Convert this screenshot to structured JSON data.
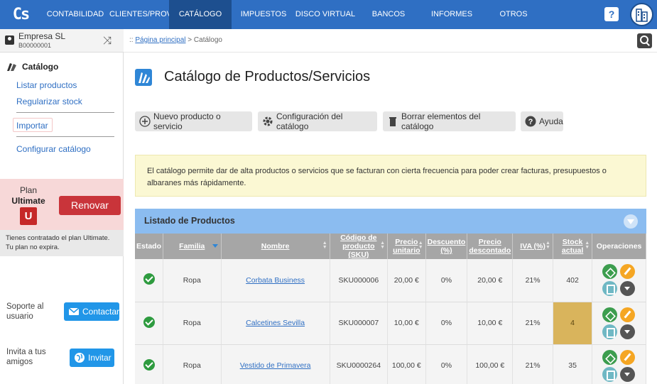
{
  "app": {
    "logo": "Cs"
  },
  "nav": {
    "items": [
      "CONTABILIDAD",
      "CLIENTES/PROV.",
      "CATÁLOGO",
      "IMPUESTOS",
      "DISCO VIRTUAL",
      "BANCOS",
      "INFORMES",
      "OTROS"
    ],
    "active": "CATÁLOGO",
    "help": "?"
  },
  "company": {
    "name": "Empresa SL",
    "id": "B00000001"
  },
  "sidebar": {
    "section": "Catálogo",
    "links": [
      "Listar productos",
      "Regularizar stock",
      "Importar",
      "Configurar catálogo"
    ]
  },
  "plan": {
    "label": "Plan",
    "name": "Ultimate",
    "badge": "U",
    "renew": "Renovar",
    "info_line1": "Tienes contratado el plan Ultimate.",
    "info_line2": "Tu plan no expira."
  },
  "support": {
    "label_line1": "Soporte al",
    "label_line2": "usuario",
    "button": "Contactar"
  },
  "invite": {
    "label_line1": "Invita a tus",
    "label_line2": "amigos",
    "button": "Invitar"
  },
  "breadcrumb": {
    "home": "Página principal",
    "prefix": ":: ",
    "sep": " > ",
    "current": "Catálogo"
  },
  "page": {
    "title": "Catálogo de Productos/Servicios"
  },
  "toolbar": {
    "new": "Nuevo producto o servicio",
    "config": "Configuración del catálogo",
    "delete": "Borrar elementos del catálogo",
    "help": "Ayuda"
  },
  "notice": "El catálogo permite dar de alta productos o servicios que se facturan con cierta frecuencia para poder crear facturas, presupuestos o albaranes más rápidamente.",
  "listing": {
    "title": "Listado de Productos",
    "columns": {
      "estado": "Estado",
      "familia": "Familia",
      "nombre": "Nombre",
      "sku_1": "Código de",
      "sku_2": "producto (SKU)",
      "precio_1": "Precio",
      "precio_2": "unitario",
      "desc_1": "Descuento",
      "desc_2": "(%)",
      "pdesc_1": "Precio",
      "pdesc_2": "descontado",
      "iva": "IVA (%)",
      "stock_1": "Stock",
      "stock_2": "actual",
      "ops": "Operaciones"
    },
    "rows": [
      {
        "familia": "Ropa",
        "nombre": "Corbata Business",
        "sku": "SKU000006",
        "precio": "20,00 €",
        "descuento": "0%",
        "precio_desc": "20,00 €",
        "iva": "21%",
        "stock": "402"
      },
      {
        "familia": "Ropa",
        "nombre": "Calcetines Sevilla",
        "sku": "SKU000007",
        "precio": "10,00 €",
        "descuento": "0%",
        "precio_desc": "10,00 €",
        "iva": "21%",
        "stock": "4"
      },
      {
        "familia": "Ropa",
        "nombre": "Vestido de Primavera",
        "sku": "SKU0000264",
        "precio": "100,00 €",
        "descuento": "0%",
        "precio_desc": "100,00 €",
        "iva": "21%",
        "stock": "35"
      }
    ]
  },
  "colors": {
    "nav": "#2f6fc3",
    "nav_active": "#1d4f8f",
    "low_stock": "#d9b45c",
    "renew": "#c9343a"
  }
}
